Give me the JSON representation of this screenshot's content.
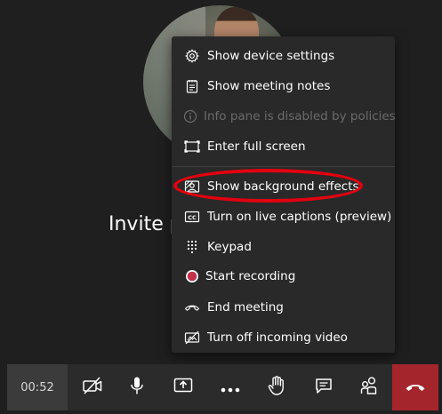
{
  "participant": {
    "invite_text": "Invite p"
  },
  "menu": {
    "items": [
      {
        "label": "Show device settings",
        "icon": "gear-icon"
      },
      {
        "label": "Show meeting notes",
        "icon": "notes-icon"
      },
      {
        "label": "Info pane is disabled by policies",
        "icon": "info-icon",
        "disabled": true
      },
      {
        "label": "Enter full screen",
        "icon": "fullscreen-icon"
      },
      {
        "label": "Show background effects",
        "icon": "background-effects-icon"
      },
      {
        "label": "Turn on live captions (preview)",
        "icon": "captions-icon"
      },
      {
        "label": "Keypad",
        "icon": "keypad-icon"
      },
      {
        "label": "Start recording",
        "icon": "record-icon"
      },
      {
        "label": "End meeting",
        "icon": "end-meeting-icon"
      },
      {
        "label": "Turn off incoming video",
        "icon": "video-off-icon"
      }
    ]
  },
  "toolbar": {
    "timer": "00:52",
    "buttons": [
      {
        "name": "camera-off-button",
        "icon": "camera-off-icon"
      },
      {
        "name": "microphone-button",
        "icon": "microphone-icon"
      },
      {
        "name": "share-button",
        "icon": "share-icon"
      },
      {
        "name": "more-actions-button",
        "icon": "more-icon"
      },
      {
        "name": "raise-hand-button",
        "icon": "hand-icon"
      },
      {
        "name": "chat-button",
        "icon": "chat-icon"
      },
      {
        "name": "participants-button",
        "icon": "participants-icon"
      },
      {
        "name": "hang-up-button",
        "icon": "hang-up-icon"
      }
    ]
  },
  "colors": {
    "background": "#1f1f1f",
    "menu_bg": "#292929",
    "toolbar_bg": "#2b2b2b",
    "hangup_red": "#a4262c",
    "highlight_red": "#e3000f",
    "record_red": "#c4314b"
  }
}
